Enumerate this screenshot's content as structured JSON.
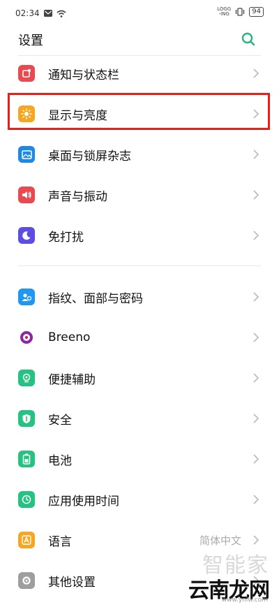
{
  "status_bar": {
    "time": "02:34",
    "carrier_tag": "LOGG\n-ING",
    "battery": "94"
  },
  "header": {
    "title": "设置"
  },
  "groups": [
    {
      "items": [
        {
          "label": "通知与状态栏",
          "icon": "notification-icon",
          "color": "#e84a4f"
        },
        {
          "label": "显示与亮度",
          "icon": "brightness-icon",
          "color": "#f5a623"
        },
        {
          "label": "桌面与锁屏杂志",
          "icon": "wallpaper-icon",
          "color": "#1e88e5"
        },
        {
          "label": "声音与振动",
          "icon": "sound-icon",
          "color": "#e84a4f"
        },
        {
          "label": "免打扰",
          "icon": "moon-icon",
          "color": "#5c4ee5"
        }
      ]
    },
    {
      "items": [
        {
          "label": "指纹、面部与密码",
          "icon": "user-security-icon",
          "color": "#2196f3"
        },
        {
          "label": "Breeno",
          "icon": "breeno-icon",
          "color": "#8e24aa"
        },
        {
          "label": "便捷辅助",
          "icon": "assist-icon",
          "color": "#26c281"
        },
        {
          "label": "安全",
          "icon": "shield-icon",
          "color": "#26c281"
        },
        {
          "label": "电池",
          "icon": "battery-icon",
          "color": "#26c281"
        },
        {
          "label": "应用使用时间",
          "icon": "app-time-icon",
          "color": "#26c281"
        },
        {
          "label": "语言",
          "icon": "language-icon",
          "color": "#f5a623",
          "value": "简体中文"
        },
        {
          "label": "其他设置",
          "icon": "other-settings-icon",
          "color": "#9e9e9e"
        }
      ]
    }
  ],
  "watermark": {
    "line1": "智能家",
    "line2": "云南龙网",
    "url": "www.ynlw.com"
  },
  "colors": {
    "accent": "#26b67c",
    "highlight": "#e8201a"
  }
}
